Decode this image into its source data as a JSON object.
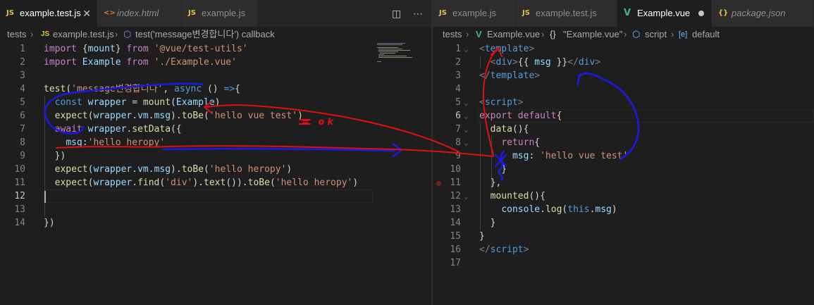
{
  "left": {
    "tabs": [
      {
        "icon": "JS",
        "label": "example.test.js",
        "active": true,
        "close": "✕"
      },
      {
        "icon": "<>",
        "label": "index.html",
        "active": false
      },
      {
        "icon": "JS",
        "label": "example.js",
        "active": false
      }
    ],
    "breadcrumb": {
      "folder": "tests",
      "file": "example.test.js",
      "symbol": "test('message변경합니다') callback"
    },
    "line_numbers": [
      "1",
      "2",
      "3",
      "4",
      "5",
      "6",
      "7",
      "8",
      "9",
      "10",
      "11",
      "12",
      "13",
      "14"
    ]
  },
  "right": {
    "tabs": [
      {
        "icon": "JS",
        "label": "example.js",
        "active": false
      },
      {
        "icon": "JS",
        "label": "example.test.js",
        "active": false
      },
      {
        "icon": "V",
        "label": "Example.vue",
        "active": true
      },
      {
        "icon": "{}",
        "label": "package.json",
        "active": false
      }
    ],
    "breadcrumb": {
      "folder": "tests",
      "file": "Example.vue",
      "obj": "\"Example.vue\"",
      "script": "script",
      "default": "default"
    },
    "line_numbers": [
      "1",
      "2",
      "3",
      "4",
      "5",
      "6",
      "7",
      "8",
      "9",
      "10",
      "11",
      "12",
      "13",
      "14",
      "15",
      "16",
      "17"
    ]
  },
  "annotation_text": "= ok",
  "colors": {
    "editor_bg": "#1e1e1e",
    "tab_bg": "#2d2d2d",
    "annotation_red": "#e01010",
    "annotation_blue": "#1a1ae6"
  }
}
